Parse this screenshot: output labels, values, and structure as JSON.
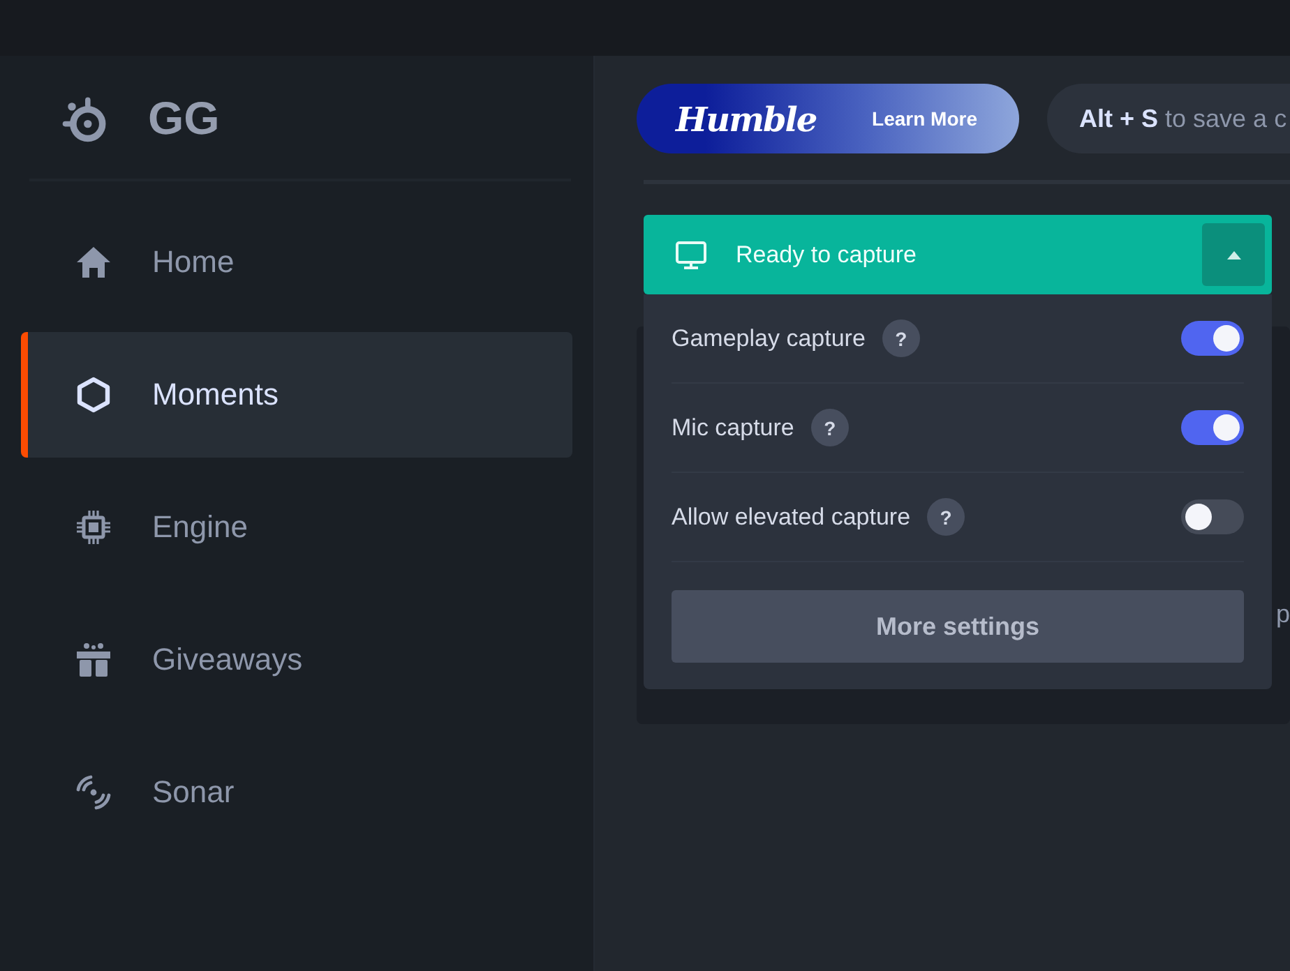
{
  "sidebar": {
    "logo": "GG",
    "items": [
      {
        "label": "Home",
        "selected": false
      },
      {
        "label": "Moments",
        "selected": true
      },
      {
        "label": "Engine",
        "selected": false
      },
      {
        "label": "Giveaways",
        "selected": false
      },
      {
        "label": "Sonar",
        "selected": false
      }
    ]
  },
  "banner": {
    "brand": "Humble",
    "action": "Learn More"
  },
  "hint": "**Alt + S** to save a c",
  "capture": {
    "status": "Ready to capture",
    "expanded": true,
    "options": [
      {
        "label": "Gameplay capture",
        "help": "?",
        "checked": true
      },
      {
        "label": "Mic capture",
        "help": "?",
        "checked": true
      },
      {
        "label": "Allow elevated capture",
        "help": "?",
        "checked": false
      }
    ],
    "button": "More settings"
  },
  "background_text": "p"
}
